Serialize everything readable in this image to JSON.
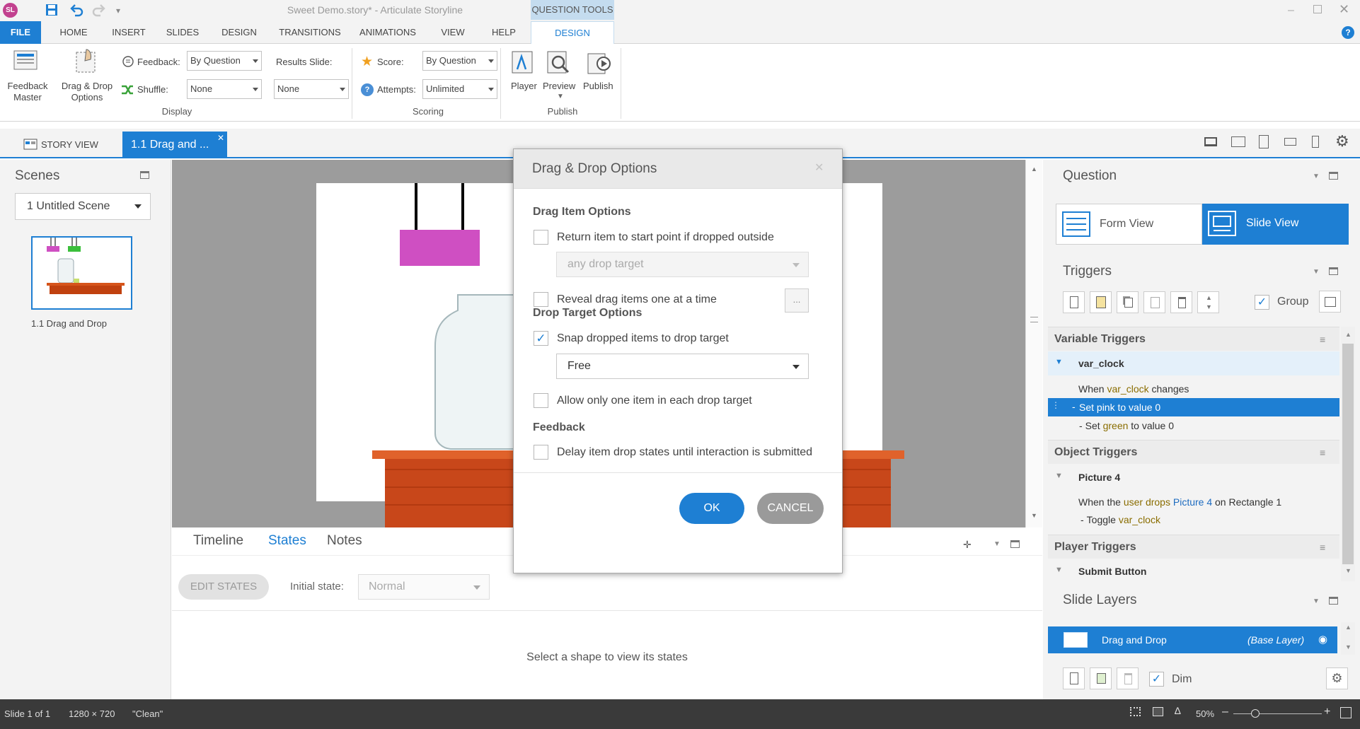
{
  "titlebar": {
    "title": "Sweet Demo.story* - Articulate Storyline",
    "question_tools": "QUESTION TOOLS",
    "app_icon": "SL"
  },
  "ribbon_tabs": [
    "FILE",
    "HOME",
    "INSERT",
    "SLIDES",
    "DESIGN",
    "TRANSITIONS",
    "ANIMATIONS",
    "VIEW",
    "HELP"
  ],
  "ribbon_tab_design2": "DESIGN",
  "ribbon": {
    "feedback_master": "Feedback Master",
    "drag_drop_options": "Drag & Drop Options",
    "feedback_label": "Feedback:",
    "feedback_value": "By Question",
    "shuffle_label": "Shuffle:",
    "shuffle_value": "None",
    "results_slide_label": "Results Slide:",
    "results_slide_value": "None",
    "display_group": "Display",
    "score_label": "Score:",
    "score_value": "By Question",
    "attempts_label": "Attempts:",
    "attempts_value": "Unlimited",
    "scoring_group": "Scoring",
    "player": "Player",
    "preview": "Preview",
    "publish": "Publish",
    "publish_group": "Publish"
  },
  "view_tabs": {
    "story_view": "STORY VIEW",
    "slide_tab": "1.1 Drag and ..."
  },
  "scenes": {
    "title": "Scenes",
    "scene_select": "1 Untitled Scene",
    "slide_label": "1.1 Drag and Drop"
  },
  "bottom_tabs": {
    "timeline": "Timeline",
    "states": "States",
    "notes": "Notes"
  },
  "states": {
    "edit_states": "EDIT STATES",
    "initial_state_label": "Initial state:",
    "initial_state_value": "Normal",
    "empty_message": "Select a shape to view its states"
  },
  "question_panel": {
    "title": "Question",
    "form_view": "Form View",
    "slide_view": "Slide View"
  },
  "triggers_panel": {
    "title": "Triggers",
    "group_label": "Group"
  },
  "variable_triggers": {
    "title": "Variable Triggers",
    "var_name": "var_clock",
    "when_prefix": "When ",
    "when_var": "var_clock",
    "when_suffix": " changes",
    "set1_prefix": "Set pink to value 0",
    "set2_a": "Set ",
    "set2_b": "green",
    "set2_c": " to value 0"
  },
  "object_triggers": {
    "title": "Object Triggers",
    "object_name": "Picture 4",
    "line_a": "When the ",
    "line_b": "user drops",
    "line_c": " ",
    "line_d": "Picture 4",
    "line_e": " on Rectangle 1",
    "toggle_a": "Toggle ",
    "toggle_b": "var_clock"
  },
  "player_triggers": {
    "title": "Player Triggers",
    "submit_button": "Submit Button"
  },
  "slide_layers": {
    "title": "Slide Layers",
    "layer_name": "Drag and Drop",
    "base_layer": "(Base Layer)",
    "dim_label": "Dim"
  },
  "statusbar": {
    "slide": "Slide 1 of 1",
    "size": "1280 × 720",
    "theme": "\"Clean\"",
    "zoom": "50%"
  },
  "dialog": {
    "title": "Drag & Drop Options",
    "drag_item_section": "Drag Item Options",
    "return_item": "Return item to start point if dropped outside",
    "return_item_checked": false,
    "drop_target_select": "any drop target",
    "reveal_items": "Reveal drag items one at a time",
    "reveal_items_checked": false,
    "ellipsis": "...",
    "drop_target_section": "Drop Target Options",
    "snap_items": "Snap dropped items to drop target",
    "snap_items_checked": true,
    "snap_mode": "Free",
    "only_one": "Allow only one item in each drop target",
    "only_one_checked": false,
    "feedback_section": "Feedback",
    "delay_states": "Delay item drop states until interaction is submitted",
    "delay_states_checked": false,
    "ok": "OK",
    "cancel": "CANCEL"
  },
  "colors": {
    "accent": "#1e7fd3",
    "pink": "#cf4fc2",
    "wood": "#d6541b",
    "statusbar": "#3a3a3a"
  }
}
